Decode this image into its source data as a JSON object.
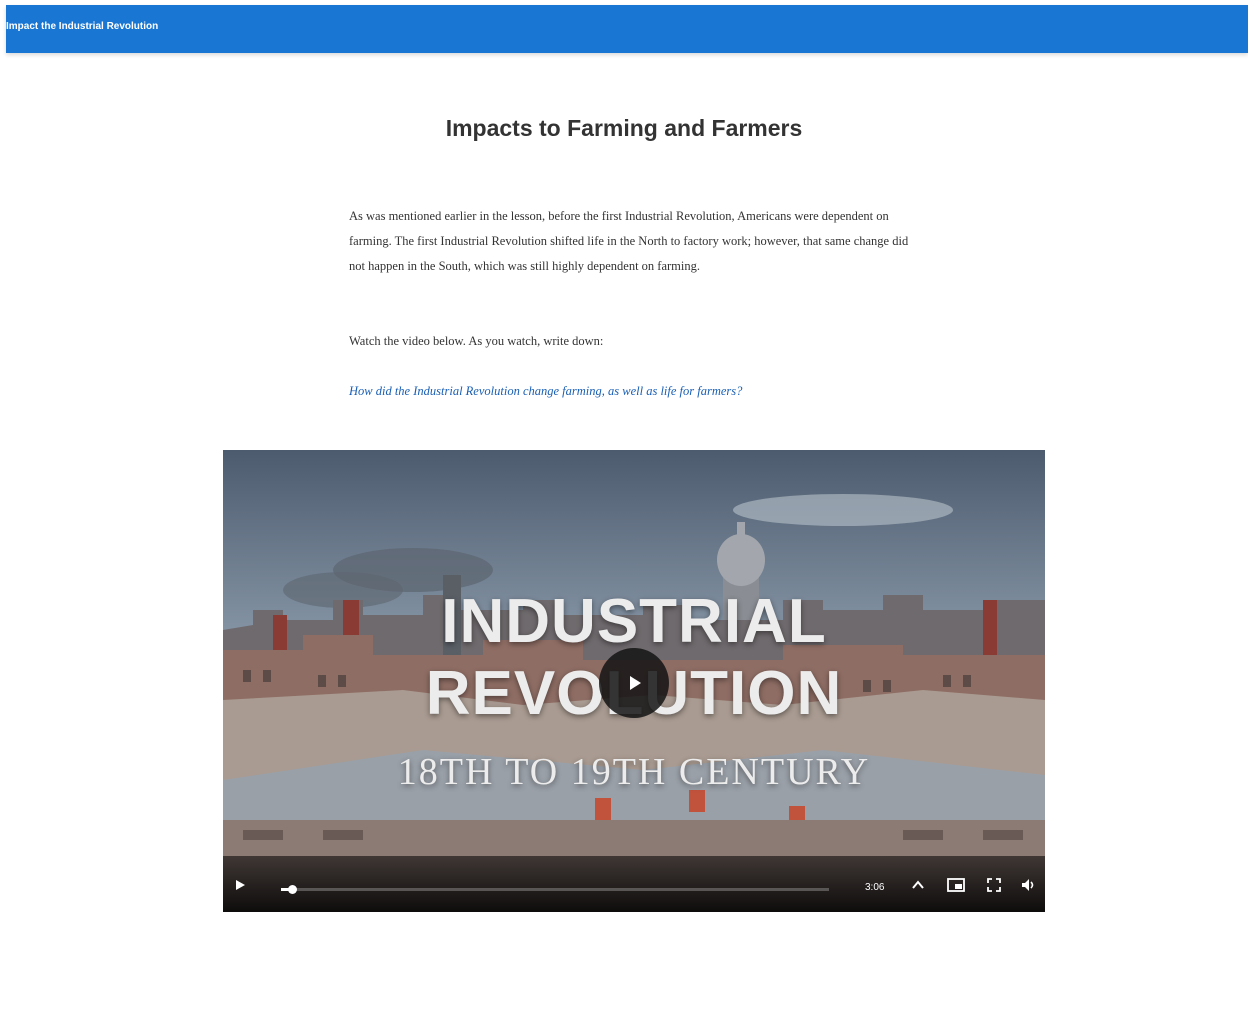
{
  "topbar": {
    "title": "Impact the Industrial Revolution"
  },
  "lesson": {
    "title": "Impacts to Farming and Farmers",
    "paragraph1": "As was mentioned earlier in the lesson, before the first Industrial Revolution, Americans were dependent on farming. The first Industrial Revolution shifted life in the North to factory work; however, that same change did not happen in the South, which was still highly dependent on farming.",
    "paragraph2": "Watch the video below. As you watch, write down:",
    "question": "How did the Industrial Revolution change farming, as well as life for farmers?"
  },
  "video": {
    "title_line1": "Industrial",
    "title_line2": "Revolution",
    "subtitle": "18th to 19th century",
    "time": "3:06",
    "progress": 0.02
  },
  "icons": {
    "play": "play-icon",
    "speed": "playback-speed-icon",
    "pip": "picture-in-picture-icon",
    "fullscreen": "fullscreen-icon",
    "volume": "volume-icon"
  },
  "colors": {
    "topbar": "#1976d2",
    "question": "#1a5fb4"
  }
}
